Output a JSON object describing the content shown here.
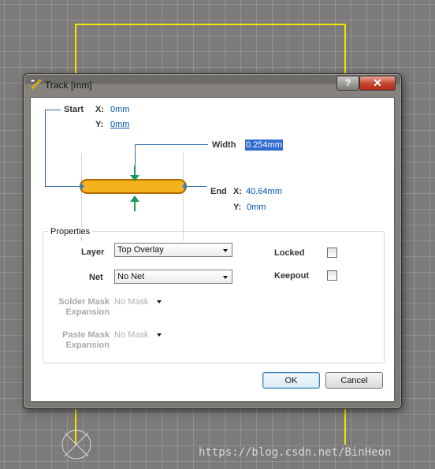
{
  "window": {
    "title": "Track [mm]",
    "help_label": "?",
    "close_label": "✕"
  },
  "start": {
    "label": "Start",
    "x_label": "X:",
    "x_value": "0mm",
    "y_label": "Y:",
    "y_value": "0mm"
  },
  "width": {
    "label": "Width",
    "value": "0.254mm"
  },
  "end": {
    "label": "End",
    "x_label": "X:",
    "x_value": "40.64mm",
    "y_label": "Y:",
    "y_value": "0mm"
  },
  "properties": {
    "group_title": "Properties",
    "layer_label": "Layer",
    "layer_value": "Top Overlay",
    "net_label": "Net",
    "net_value": "No Net",
    "solder_mask_label_1": "Solder Mask",
    "solder_mask_label_2": "Expansion",
    "solder_mask_value": "No Mask",
    "paste_mask_label_1": "Paste Mask",
    "paste_mask_label_2": "Expansion",
    "paste_mask_value": "No Mask",
    "locked_label": "Locked",
    "locked_checked": false,
    "keepout_label": "Keepout",
    "keepout_checked": false
  },
  "buttons": {
    "ok": "OK",
    "cancel": "Cancel"
  },
  "watermark": "https://blog.csdn.net/BinHeon",
  "colors": {
    "track_fill": "#f5b21c",
    "track_border": "#b06a00",
    "accent_blue": "#0055aa",
    "arrow_green": "#1c9a57",
    "canvas_yellow": "#f2e600",
    "close_red": "#c2442c"
  }
}
